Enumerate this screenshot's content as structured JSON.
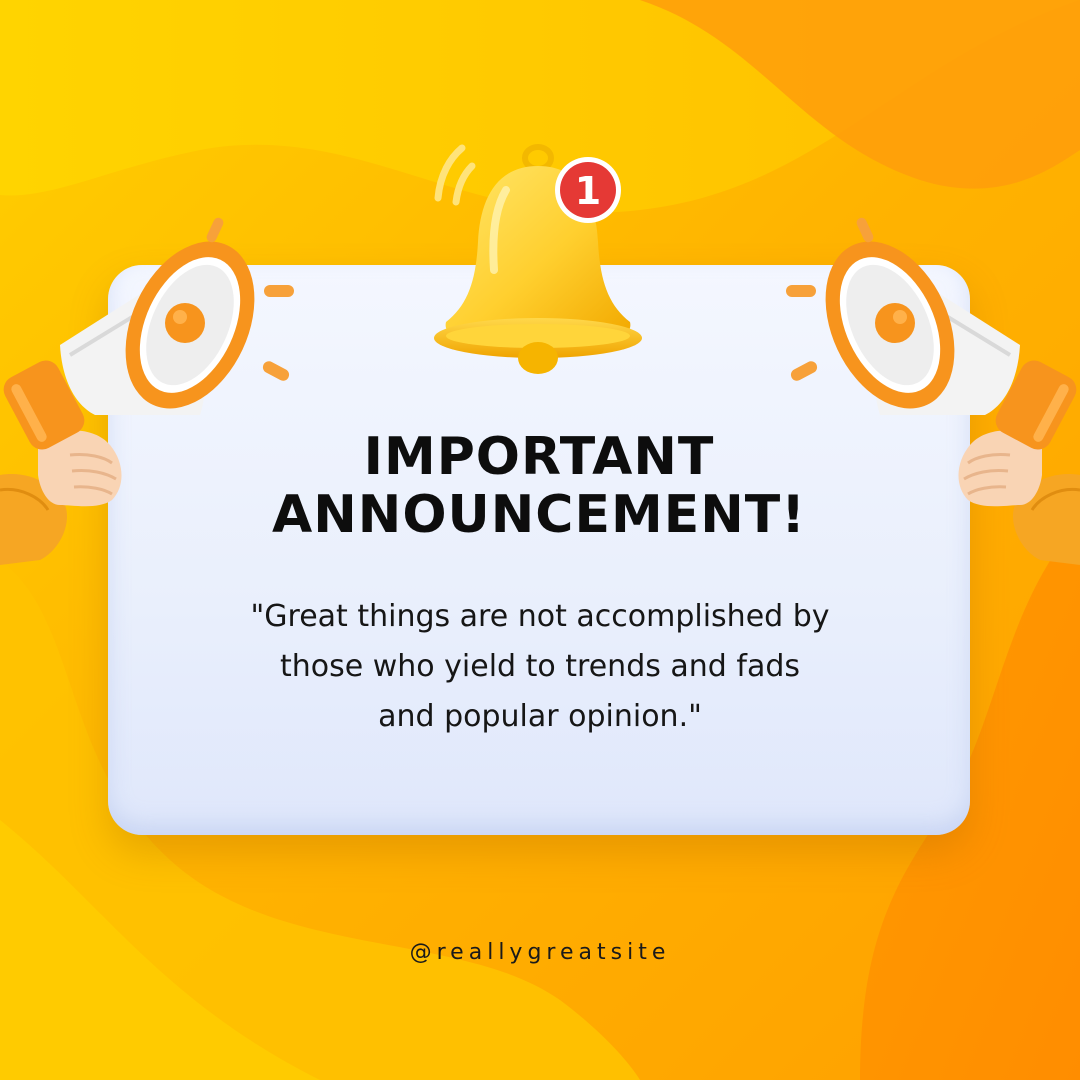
{
  "headline": {
    "line1": "IMPORTANT",
    "line2": "ANNOUNCEMENT!"
  },
  "quote": {
    "line1": "\"Great things are not accomplished by",
    "line2": "those who yield to trends and fads",
    "line3": "and popular opinion.\""
  },
  "notification": {
    "badge_count": "1",
    "icon": "bell-icon"
  },
  "megaphones": {
    "left_icon": "megaphone-icon",
    "right_icon": "megaphone-icon"
  },
  "footer": {
    "handle": "@reallygreatsite"
  },
  "colors": {
    "background_light": "#ffd000",
    "background_dark": "#ff9800",
    "card": "#eef2fd",
    "accent_orange": "#f7941d",
    "badge_red": "#e53935",
    "bell_yellow": "#ffd23f",
    "text": "#0d0d0d"
  }
}
